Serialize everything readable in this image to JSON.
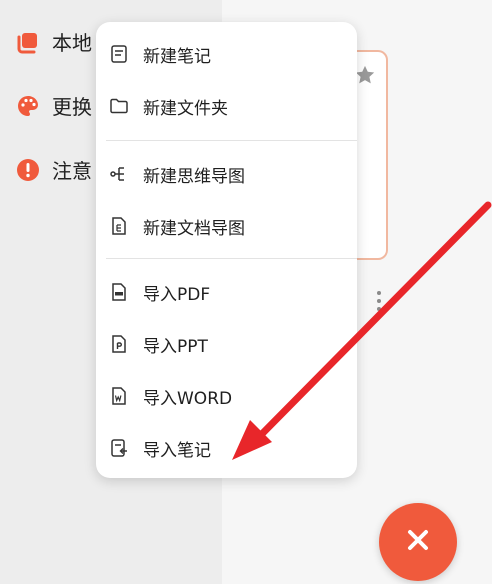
{
  "sidebar": {
    "items": [
      {
        "label": "本地",
        "icon": "folder-stack-icon"
      },
      {
        "label": "更换",
        "icon": "palette-icon"
      },
      {
        "label": "注意",
        "icon": "alert-icon"
      }
    ]
  },
  "menu": {
    "items": [
      {
        "label": "新建笔记",
        "icon": "note-icon"
      },
      {
        "label": "新建文件夹",
        "icon": "folder-icon"
      },
      {
        "label": "新建思维导图",
        "icon": "mindmap-icon"
      },
      {
        "label": "新建文档导图",
        "icon": "doc-map-icon"
      },
      {
        "label": "导入PDF",
        "icon": "pdf-file-icon"
      },
      {
        "label": "导入PPT",
        "icon": "ppt-file-icon"
      },
      {
        "label": "导入WORD",
        "icon": "word-file-icon"
      },
      {
        "label": "导入笔记",
        "icon": "import-note-icon"
      }
    ]
  },
  "colors": {
    "accent": "#f05a3c",
    "arrow": "#e8262a"
  },
  "fab": {
    "icon": "close-icon"
  }
}
